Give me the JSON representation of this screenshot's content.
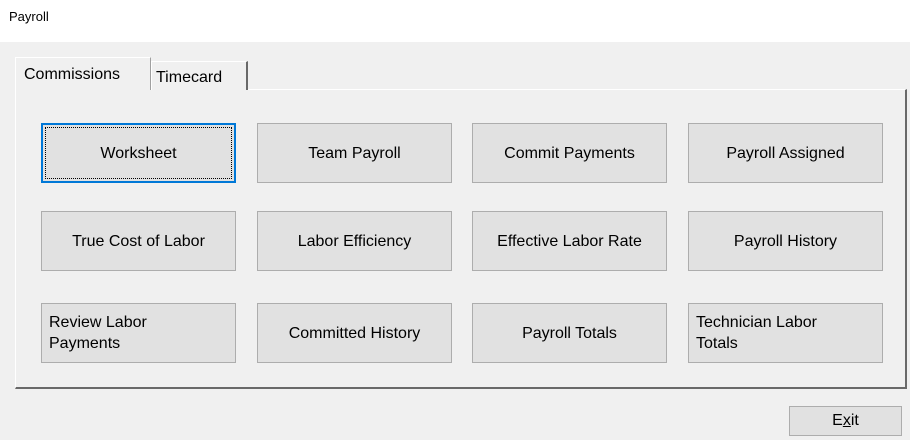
{
  "window": {
    "title": "Payroll"
  },
  "tabs": [
    {
      "label": "Commissions",
      "active": true
    },
    {
      "label": "Timecard",
      "active": false
    }
  ],
  "buttons": {
    "worksheet": "Worksheet",
    "team_payroll": "Team Payroll",
    "commit_payments": "Commit Payments",
    "payroll_assigned": "Payroll Assigned",
    "true_cost_of_labor": "True Cost of Labor",
    "labor_efficiency": "Labor Efficiency",
    "effective_labor_rate": "Effective Labor Rate",
    "payroll_history": "Payroll History",
    "review_labor_payments": "Review Labor Payments",
    "committed_history": "Committed History",
    "payroll_totals": "Payroll Totals",
    "technician_labor_totals": "Technician Labor Totals"
  },
  "exit": {
    "prefix": "E",
    "mnemonic": "x",
    "suffix": "it"
  },
  "colors": {
    "focus_border": "#0078d7",
    "button_face": "#e1e1e1",
    "window_background": "#f0f0f0"
  }
}
